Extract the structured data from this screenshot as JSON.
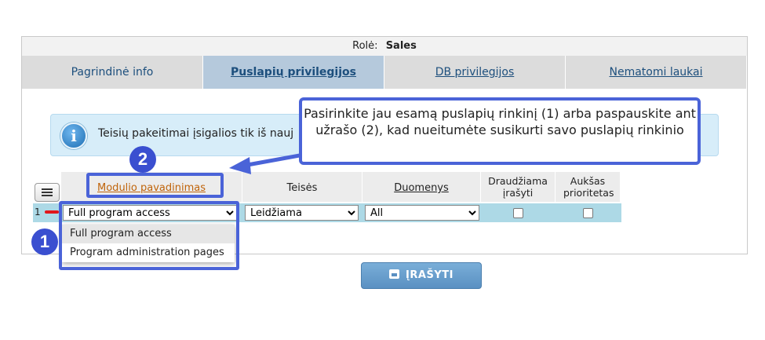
{
  "role": {
    "label": "Rolė:",
    "value": "Sales"
  },
  "tabs": [
    {
      "label": "Pagrindinė info"
    },
    {
      "label": "Puslapių privilegijos"
    },
    {
      "label": "DB privilegijos"
    },
    {
      "label": "Nematomi laukai"
    }
  ],
  "info": {
    "text": "Teisių pakeitimai įsigalios tik iš nauj"
  },
  "table": {
    "headers": [
      "Modulio pavadinimas",
      "Teisės",
      "Duomenys",
      "Draudžiama įrašyti",
      "Aukšas prioritetas"
    ],
    "row": {
      "index": "1",
      "module": "Full program access",
      "rights": "Leidžiama",
      "data": "All"
    }
  },
  "dropdown_options": [
    "Full program access",
    "Program administration pages"
  ],
  "callout": {
    "text": "Pasirinkite jau esamą puslapių rinkinį (1) arba paspauskite ant užrašo (2), kad nueitumėte susikurti savo puslapių rinkinio"
  },
  "badges": {
    "one": "1",
    "two": "2"
  },
  "save_button": {
    "label": "ĮRAŠYTI"
  },
  "colors": {
    "highlight": "#4a63d8",
    "row_bg": "#add9e6",
    "header_link": "#c0640a"
  }
}
